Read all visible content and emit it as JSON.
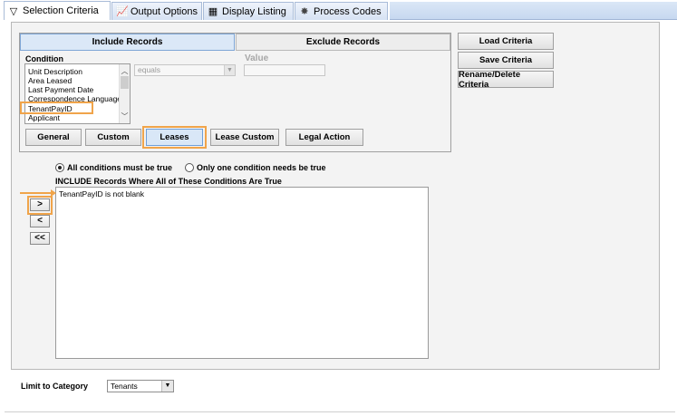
{
  "tabs": [
    {
      "label": "Selection Criteria",
      "icon": "funnel-icon"
    },
    {
      "label": "Output Options",
      "icon": "chart-icon"
    },
    {
      "label": "Display Listing",
      "icon": "grid-icon"
    },
    {
      "label": "Process Codes",
      "icon": "wand-icon"
    }
  ],
  "criteria": {
    "include_label": "Include Records",
    "exclude_label": "Exclude Records",
    "condition_label": "Condition",
    "value_label": "Value",
    "condition_items": [
      "Unit Description",
      "Area Leased",
      "Last Payment Date",
      "Correspondence Language",
      "TenantPayID",
      "Applicant"
    ],
    "operator_value": "equals",
    "value": ""
  },
  "category_buttons": [
    {
      "label": "General"
    },
    {
      "label": "Custom"
    },
    {
      "label": "Leases"
    },
    {
      "label": "Lease Custom"
    },
    {
      "label": "Legal Action"
    }
  ],
  "right_buttons": {
    "load": "Load Criteria",
    "save": "Save Criteria",
    "rename": "Rename/Delete Criteria"
  },
  "logic": {
    "all_label": "All conditions must be true",
    "one_label": "Only one condition needs be true",
    "include_heading": "INCLUDE Records Where All of These Conditions Are True",
    "conditions": [
      "TenantPayID is not blank"
    ]
  },
  "move_buttons": {
    "add": ">",
    "remove": "<",
    "remove_all": "<<"
  },
  "footer": {
    "limit_label": "Limit to Category",
    "category_value": "Tenants"
  }
}
